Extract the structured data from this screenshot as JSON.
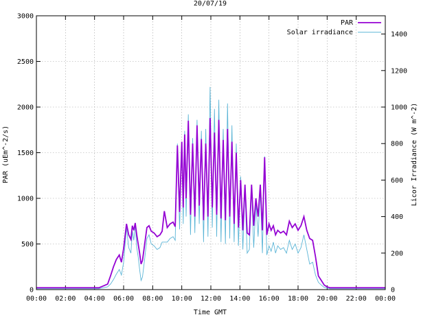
{
  "chart_data": {
    "type": "line",
    "title": "20/07/19",
    "xlabel": "Time GMT",
    "ylabel_left": "PAR (uEm^-2/s)",
    "ylabel_right": "Licor Irradiance (W m^-2)",
    "x_ticks": [
      "00:00",
      "02:00",
      "04:00",
      "06:00",
      "08:00",
      "10:00",
      "12:00",
      "14:00",
      "16:00",
      "18:00",
      "20:00",
      "22:00",
      "00:00"
    ],
    "xlim_hours": [
      0,
      24
    ],
    "ylim_left": [
      0,
      3000
    ],
    "ylim_right": [
      0,
      1500
    ],
    "y_ticks_left": [
      0,
      500,
      1000,
      1500,
      2000,
      2500,
      3000
    ],
    "y_ticks_right": [
      0,
      200,
      400,
      600,
      800,
      1000,
      1200,
      1400
    ],
    "grid": true,
    "legend_position": "top-right",
    "series": [
      {
        "name": "PAR",
        "axis": "left",
        "color": "#9400d3",
        "x_hours": [
          0,
          4.3,
          4.6,
          4.9,
          5.1,
          5.3,
          5.5,
          5.7,
          5.85,
          6.0,
          6.2,
          6.35,
          6.5,
          6.6,
          6.7,
          6.8,
          6.9,
          7.0,
          7.1,
          7.2,
          7.3,
          7.45,
          7.6,
          7.75,
          7.9,
          8.1,
          8.3,
          8.5,
          8.65,
          8.8,
          9.0,
          9.2,
          9.4,
          9.55,
          9.7,
          9.85,
          10.0,
          10.1,
          10.2,
          10.3,
          10.45,
          10.6,
          10.75,
          10.9,
          11.05,
          11.2,
          11.35,
          11.5,
          11.65,
          11.8,
          11.95,
          12.1,
          12.25,
          12.4,
          12.55,
          12.7,
          12.85,
          13.0,
          13.15,
          13.3,
          13.45,
          13.6,
          13.75,
          13.9,
          14.05,
          14.2,
          14.35,
          14.5,
          14.65,
          14.8,
          14.95,
          15.1,
          15.25,
          15.4,
          15.55,
          15.7,
          15.85,
          16.0,
          16.15,
          16.3,
          16.45,
          16.6,
          16.8,
          17.0,
          17.2,
          17.4,
          17.6,
          17.8,
          18.0,
          18.2,
          18.4,
          18.6,
          18.8,
          19.0,
          19.2,
          19.4,
          19.6,
          19.8,
          20.0,
          20.2,
          20.4,
          20.6,
          21.0,
          22.0,
          24.0
        ],
        "values": [
          20,
          20,
          40,
          60,
          150,
          250,
          330,
          380,
          300,
          450,
          720,
          600,
          550,
          700,
          650,
          730,
          600,
          500,
          400,
          280,
          320,
          500,
          680,
          700,
          640,
          620,
          580,
          600,
          640,
          860,
          680,
          720,
          740,
          690,
          1580,
          850,
          1620,
          900,
          1700,
          1000,
          1850,
          820,
          1600,
          800,
          1800,
          920,
          1650,
          760,
          1600,
          800,
          1880,
          900,
          1720,
          820,
          1860,
          780,
          1640,
          760,
          1760,
          800,
          1620,
          720,
          1500,
          680,
          1200,
          650,
          1150,
          620,
          600,
          1150,
          700,
          1000,
          800,
          1150,
          650,
          1450,
          600,
          720,
          650,
          700,
          600,
          650,
          620,
          640,
          600,
          750,
          680,
          720,
          650,
          700,
          800,
          650,
          560,
          540,
          360,
          150,
          100,
          50,
          30,
          20,
          20,
          20,
          20,
          20,
          20
        ]
      },
      {
        "name": "Solar irradiance",
        "axis": "right",
        "color": "#5ab4d6",
        "x_hours": [
          0,
          4.3,
          4.6,
          4.9,
          5.1,
          5.3,
          5.5,
          5.7,
          5.85,
          6.0,
          6.2,
          6.35,
          6.5,
          6.6,
          6.7,
          6.8,
          6.9,
          7.0,
          7.1,
          7.2,
          7.3,
          7.45,
          7.6,
          7.75,
          7.9,
          8.1,
          8.3,
          8.5,
          8.65,
          8.8,
          9.0,
          9.2,
          9.4,
          9.55,
          9.7,
          9.85,
          10.0,
          10.1,
          10.2,
          10.3,
          10.45,
          10.6,
          10.75,
          10.9,
          11.05,
          11.2,
          11.35,
          11.5,
          11.65,
          11.8,
          11.95,
          12.1,
          12.25,
          12.4,
          12.55,
          12.7,
          12.85,
          13.0,
          13.15,
          13.3,
          13.45,
          13.6,
          13.75,
          13.9,
          14.05,
          14.2,
          14.35,
          14.5,
          14.65,
          14.8,
          14.95,
          15.1,
          15.25,
          15.4,
          15.55,
          15.7,
          15.85,
          16.0,
          16.15,
          16.3,
          16.45,
          16.6,
          16.8,
          17.0,
          17.2,
          17.4,
          17.6,
          17.8,
          18.0,
          18.2,
          18.4,
          18.6,
          18.8,
          19.0,
          19.2,
          19.4,
          19.6,
          19.8,
          20.0,
          20.2,
          20.4,
          20.6,
          21.0,
          22.0,
          24.0
        ],
        "values": [
          5,
          5,
          10,
          15,
          30,
          55,
          85,
          110,
          80,
          150,
          340,
          230,
          200,
          320,
          270,
          360,
          230,
          180,
          110,
          50,
          70,
          170,
          280,
          300,
          250,
          240,
          220,
          230,
          260,
          260,
          260,
          280,
          290,
          270,
          800,
          330,
          810,
          360,
          870,
          400,
          960,
          300,
          830,
          310,
          930,
          360,
          870,
          260,
          880,
          290,
          1110,
          340,
          990,
          290,
          1040,
          260,
          880,
          250,
          1020,
          280,
          900,
          260,
          800,
          240,
          620,
          220,
          550,
          200,
          220,
          560,
          230,
          470,
          290,
          550,
          200,
          730,
          190,
          240,
          210,
          260,
          200,
          240,
          220,
          230,
          200,
          270,
          220,
          250,
          200,
          230,
          300,
          220,
          140,
          150,
          80,
          40,
          25,
          12,
          8,
          5,
          5,
          5,
          5,
          5,
          5
        ]
      }
    ]
  }
}
